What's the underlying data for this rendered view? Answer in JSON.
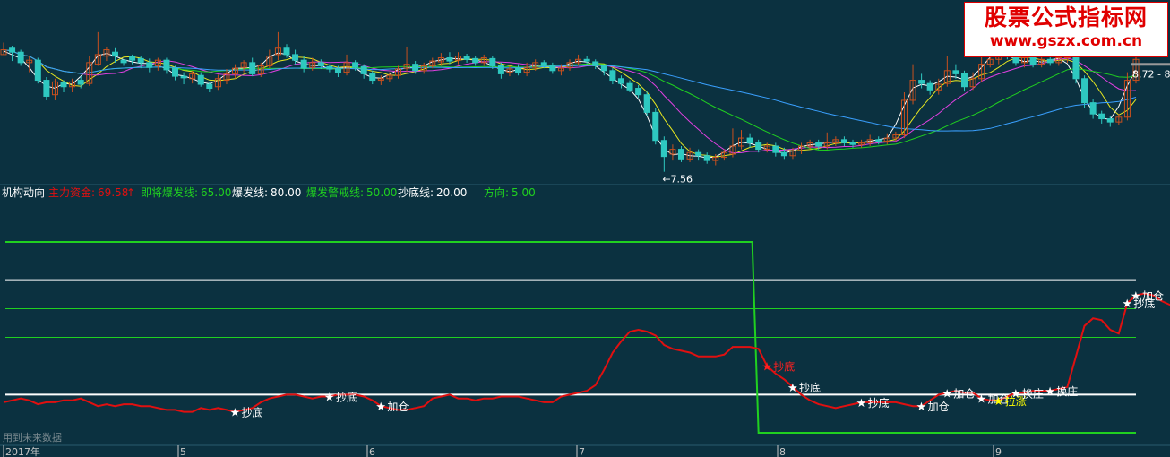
{
  "chart_data": [
    {
      "type": "candlestick",
      "panel": "price",
      "price_range": [
        7.4,
        9.7
      ],
      "low_marker": "←7.56",
      "price_tag": "8.72 - 8.",
      "candles": [
        [
          9.02,
          9.08,
          9.02,
          9.17
        ],
        [
          9.1,
          9.05,
          8.94,
          9.13
        ],
        [
          9.05,
          8.92,
          8.88,
          9.08
        ],
        [
          8.92,
          8.95,
          8.8,
          9.0
        ],
        [
          8.95,
          8.7,
          8.66,
          8.98
        ],
        [
          8.7,
          8.5,
          8.45,
          8.74
        ],
        [
          8.52,
          8.68,
          8.45,
          8.72
        ],
        [
          8.67,
          8.62,
          8.55,
          8.7
        ],
        [
          8.62,
          8.68,
          8.55,
          8.72
        ],
        [
          8.7,
          8.65,
          8.6,
          8.75
        ],
        [
          8.66,
          8.92,
          8.63,
          9.0
        ],
        [
          8.9,
          9.02,
          8.88,
          9.3
        ],
        [
          9.0,
          9.08,
          8.94,
          9.12
        ],
        [
          9.05,
          9.0,
          8.92,
          9.1
        ],
        [
          8.95,
          8.92,
          8.88,
          8.96
        ],
        [
          9.0,
          8.95,
          8.9,
          9.02
        ],
        [
          8.97,
          8.92,
          8.85,
          9.0
        ],
        [
          8.92,
          8.86,
          8.8,
          8.97
        ],
        [
          8.88,
          8.95,
          8.82,
          8.98
        ],
        [
          8.95,
          8.83,
          8.78,
          8.98
        ],
        [
          8.85,
          8.75,
          8.7,
          8.88
        ],
        [
          8.75,
          8.73,
          8.65,
          8.8
        ],
        [
          8.72,
          8.78,
          8.66,
          8.82
        ],
        [
          8.76,
          8.65,
          8.62,
          8.8
        ],
        [
          8.65,
          8.6,
          8.55,
          8.68
        ],
        [
          8.62,
          8.72,
          8.58,
          8.77
        ],
        [
          8.7,
          8.78,
          8.65,
          8.84
        ],
        [
          8.78,
          8.85,
          8.72,
          8.9
        ],
        [
          8.86,
          8.92,
          8.8,
          8.95
        ],
        [
          8.92,
          8.78,
          8.75,
          8.98
        ],
        [
          8.78,
          8.88,
          8.74,
          8.92
        ],
        [
          8.88,
          9.0,
          8.85,
          9.08
        ],
        [
          9.02,
          9.1,
          8.95,
          9.3
        ],
        [
          9.1,
          9.02,
          8.98,
          9.15
        ],
        [
          9.02,
          8.95,
          8.9,
          9.08
        ],
        [
          8.95,
          8.85,
          8.8,
          9.0
        ],
        [
          8.86,
          8.92,
          8.82,
          8.98
        ],
        [
          8.92,
          8.88,
          8.84,
          8.96
        ],
        [
          8.87,
          8.84,
          8.8,
          8.9
        ],
        [
          8.84,
          8.8,
          8.74,
          8.88
        ],
        [
          8.8,
          8.92,
          8.76,
          9.02
        ],
        [
          8.92,
          8.86,
          8.82,
          8.95
        ],
        [
          8.87,
          8.78,
          8.72,
          8.9
        ],
        [
          8.78,
          8.7,
          8.65,
          8.82
        ],
        [
          8.7,
          8.72,
          8.64,
          8.76
        ],
        [
          8.72,
          8.76,
          8.68,
          8.8
        ],
        [
          8.76,
          8.84,
          8.72,
          8.88
        ],
        [
          8.85,
          8.9,
          8.8,
          9.12
        ],
        [
          8.9,
          8.82,
          8.78,
          8.94
        ],
        [
          8.82,
          8.88,
          8.78,
          8.92
        ],
        [
          8.88,
          8.94,
          8.85,
          8.98
        ],
        [
          8.93,
          8.98,
          8.88,
          9.04
        ],
        [
          8.98,
          8.94,
          8.9,
          9.05
        ],
        [
          8.95,
          9.0,
          8.9,
          9.05
        ],
        [
          9.0,
          8.96,
          8.92,
          9.03
        ],
        [
          8.97,
          8.92,
          8.88,
          9.0
        ],
        [
          8.92,
          8.98,
          8.88,
          9.02
        ],
        [
          8.97,
          8.88,
          8.84,
          9.0
        ],
        [
          8.88,
          8.78,
          8.72,
          8.92
        ],
        [
          8.8,
          8.84,
          8.75,
          8.88
        ],
        [
          8.85,
          8.8,
          8.76,
          8.9
        ],
        [
          8.8,
          8.86,
          8.75,
          8.92
        ],
        [
          8.86,
          8.92,
          8.82,
          8.96
        ],
        [
          8.92,
          8.88,
          8.85,
          8.95
        ],
        [
          8.88,
          8.82,
          8.78,
          8.92
        ],
        [
          8.82,
          8.85,
          8.76,
          8.9
        ],
        [
          8.86,
          8.92,
          8.82,
          8.96
        ],
        [
          8.92,
          8.96,
          8.88,
          9.02
        ],
        [
          8.96,
          8.94,
          8.9,
          9.0
        ],
        [
          8.93,
          8.88,
          8.84,
          8.96
        ],
        [
          8.88,
          8.82,
          8.76,
          8.9
        ],
        [
          8.82,
          8.7,
          8.65,
          8.85
        ],
        [
          8.72,
          8.66,
          8.6,
          8.76
        ],
        [
          8.66,
          8.58,
          8.55,
          8.7
        ],
        [
          8.6,
          8.52,
          8.48,
          8.64
        ],
        [
          8.52,
          8.3,
          8.25,
          8.56
        ],
        [
          8.3,
          7.95,
          7.9,
          8.35
        ],
        [
          7.95,
          7.75,
          7.56,
          8.0
        ],
        [
          7.78,
          7.84,
          7.7,
          7.9
        ],
        [
          7.84,
          7.72,
          7.68,
          7.88
        ],
        [
          7.72,
          7.8,
          7.68,
          7.86
        ],
        [
          7.8,
          7.76,
          7.7,
          7.84
        ],
        [
          7.76,
          7.7,
          7.66,
          7.8
        ],
        [
          7.7,
          7.74,
          7.64,
          7.78
        ],
        [
          7.74,
          7.8,
          7.7,
          7.84
        ],
        [
          7.78,
          7.88,
          7.74,
          8.1
        ],
        [
          7.88,
          7.98,
          7.84,
          8.08
        ],
        [
          7.98,
          7.92,
          7.86,
          8.04
        ],
        [
          7.92,
          7.84,
          7.8,
          7.96
        ],
        [
          7.84,
          7.88,
          7.8,
          7.92
        ],
        [
          7.88,
          7.8,
          7.75,
          7.92
        ],
        [
          7.8,
          7.76,
          7.72,
          7.86
        ],
        [
          7.76,
          7.82,
          7.72,
          7.86
        ],
        [
          7.82,
          7.88,
          7.78,
          7.92
        ],
        [
          7.88,
          7.92,
          7.84,
          7.96
        ],
        [
          7.92,
          7.88,
          7.84,
          7.96
        ],
        [
          7.88,
          7.92,
          7.84,
          8.05
        ],
        [
          7.92,
          7.96,
          7.88,
          8.0
        ],
        [
          7.96,
          7.92,
          7.88,
          8.0
        ],
        [
          7.92,
          7.9,
          7.86,
          7.96
        ],
        [
          7.9,
          7.92,
          7.86,
          7.96
        ],
        [
          7.92,
          7.96,
          7.88,
          8.02
        ],
        [
          7.96,
          7.94,
          7.9,
          8.0
        ],
        [
          7.94,
          7.98,
          7.9,
          8.04
        ],
        [
          7.98,
          8.02,
          7.94,
          8.06
        ],
        [
          8.02,
          8.45,
          7.98,
          8.55
        ],
        [
          8.45,
          8.7,
          8.4,
          8.9
        ],
        [
          8.7,
          8.66,
          8.6,
          8.78
        ],
        [
          8.66,
          8.58,
          8.52,
          8.7
        ],
        [
          8.58,
          8.65,
          8.52,
          8.72
        ],
        [
          8.66,
          8.82,
          8.62,
          9.0
        ],
        [
          8.82,
          8.78,
          8.72,
          8.9
        ],
        [
          8.78,
          8.62,
          8.56,
          8.82
        ],
        [
          8.62,
          8.72,
          8.58,
          8.8
        ],
        [
          8.72,
          8.9,
          8.68,
          9.2
        ],
        [
          8.9,
          8.96,
          8.86,
          9.05
        ],
        [
          8.96,
          9.1,
          8.9,
          9.4
        ],
        [
          9.1,
          9.0,
          8.96,
          9.16
        ],
        [
          9.0,
          8.92,
          8.88,
          9.06
        ],
        [
          8.92,
          8.98,
          8.86,
          9.05
        ],
        [
          8.98,
          8.9,
          8.86,
          9.02
        ],
        [
          8.9,
          8.96,
          8.86,
          9.0
        ],
        [
          8.96,
          8.92,
          8.88,
          9.0
        ],
        [
          8.92,
          8.98,
          8.88,
          9.04
        ],
        [
          8.98,
          9.02,
          8.92,
          9.08
        ],
        [
          9.02,
          8.72,
          8.66,
          9.06
        ],
        [
          8.72,
          8.42,
          8.36,
          8.76
        ],
        [
          8.42,
          8.28,
          8.22,
          8.46
        ],
        [
          8.28,
          8.22,
          8.16,
          8.32
        ],
        [
          8.22,
          8.18,
          8.12,
          8.26
        ],
        [
          8.18,
          8.24,
          8.14,
          8.28
        ],
        [
          8.24,
          8.7,
          8.2,
          8.8
        ],
        [
          8.7,
          8.96,
          8.66,
          9.1
        ]
      ]
    },
    {
      "type": "line",
      "panel": "indicator",
      "title": "机构动向",
      "ylim": [
        0,
        100
      ],
      "x_tick_labels": [
        "2017年",
        "5",
        "6",
        "7",
        "8",
        "9"
      ],
      "series": [
        {
          "name": "主力资金",
          "value_label": "69.58",
          "color": "#e01010",
          "values": [
            16,
            17,
            18,
            17,
            15,
            16,
            16,
            17,
            17,
            18,
            16,
            14,
            15,
            14,
            15,
            15,
            14,
            14,
            13,
            12,
            12,
            11,
            11,
            13,
            12,
            13,
            12,
            11,
            12,
            13,
            16,
            18,
            19,
            20,
            20,
            19,
            18,
            19,
            19,
            20,
            20,
            20,
            19,
            17,
            14,
            13,
            12,
            12,
            13,
            14,
            18,
            19,
            20,
            18,
            18,
            17,
            18,
            18,
            19,
            19,
            19,
            18,
            17,
            16,
            16,
            19,
            20,
            21,
            22,
            25,
            33,
            42,
            48,
            53,
            54,
            53,
            51,
            46,
            44,
            43,
            42,
            40,
            40,
            40,
            41,
            45,
            45,
            45,
            44,
            35,
            31,
            28,
            24,
            20,
            17,
            15,
            14,
            13,
            14,
            15,
            16,
            16,
            16,
            16,
            16,
            15,
            14,
            14,
            17,
            20,
            21,
            22,
            21,
            21,
            18,
            17,
            17,
            19,
            21,
            21,
            22,
            22,
            22,
            23,
            24,
            40,
            56,
            60,
            59,
            54,
            52,
            68,
            72,
            73,
            72,
            69,
            67,
            67,
            68,
            70,
            71,
            71,
            66,
            45,
            30,
            23,
            21,
            20,
            19,
            51,
            70
          ]
        },
        {
          "name": "即将爆发线",
          "value_label": "65.00",
          "color": "#20d020",
          "values": [
            65,
            65
          ]
        },
        {
          "name": "爆发线",
          "value_label": "80.00",
          "color": "#ffffff",
          "values": [
            80,
            80
          ]
        },
        {
          "name": "爆发警戒线",
          "value_label": "50.00",
          "color": "#20d020",
          "values": [
            50,
            50
          ]
        },
        {
          "name": "抄底线",
          "value_label": "20.00",
          "color": "#ffffff",
          "values": [
            20,
            20
          ]
        },
        {
          "name": "方向",
          "value_label": "5.00",
          "color": "#20d020",
          "values": [
            5,
            5
          ]
        }
      ],
      "step_line": {
        "color": "#20d020",
        "high": 100,
        "low": 0,
        "drop_index": 88
      },
      "annotations": [
        {
          "i": 27,
          "text": "抄底",
          "color": "#ffffff"
        },
        {
          "i": 38,
          "text": "抄底",
          "color": "#ffffff"
        },
        {
          "i": 44,
          "text": "加仓",
          "color": "#ffffff"
        },
        {
          "i": 89,
          "text": "抄底",
          "color": "#ff2020"
        },
        {
          "i": 92,
          "text": "抄底",
          "color": "#ffffff"
        },
        {
          "i": 100,
          "text": "抄底",
          "color": "#ffffff"
        },
        {
          "i": 107,
          "text": "加仓",
          "color": "#ffffff"
        },
        {
          "i": 110,
          "text": "加仓",
          "color": "#ffffff"
        },
        {
          "i": 114,
          "text": "加仓",
          "color": "#ffffff"
        },
        {
          "i": 116,
          "text": "拉涨",
          "color": "#ffff00"
        },
        {
          "i": 118,
          "text": "换庄",
          "color": "#ffffff"
        },
        {
          "i": 122,
          "text": "换庄",
          "color": "#ffffff"
        },
        {
          "i": 131,
          "text": "抄底",
          "color": "#ffffff"
        },
        {
          "i": 132,
          "text": "加仓",
          "color": "#ffffff"
        }
      ],
      "footer_note": "用到未来数据"
    }
  ],
  "watermark": {
    "title": "股票公式指标网",
    "url": "www.gszx.com.cn"
  }
}
